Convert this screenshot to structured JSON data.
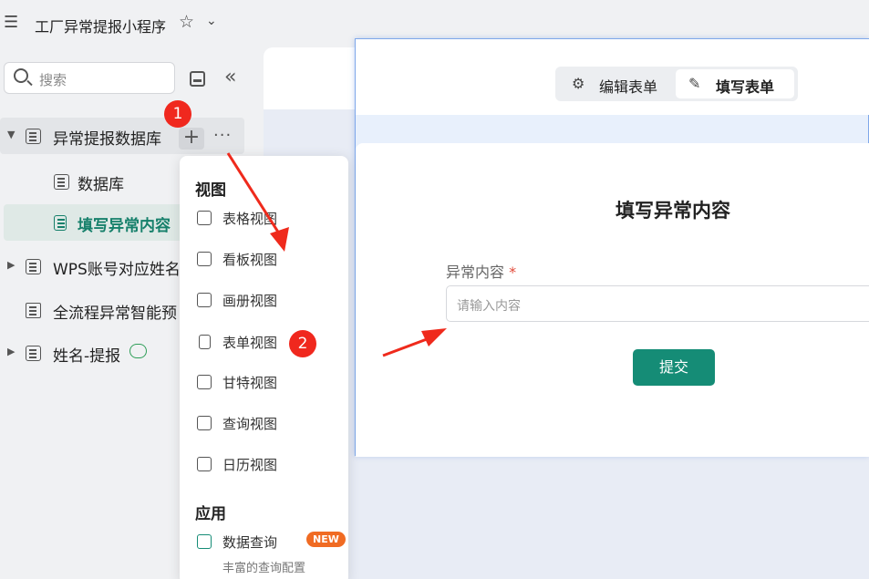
{
  "app": {
    "title": "工厂异常提报小程序",
    "menu_icon": "☰",
    "star_icon": "☆",
    "chevron_icon": "⌄"
  },
  "sidebar": {
    "search_placeholder": "搜索",
    "fold_icon": "«",
    "tree": [
      {
        "label": "异常提报数据库",
        "expanded": true
      },
      {
        "label": "数据库"
      },
      {
        "label": "填写异常内容",
        "active": true
      },
      {
        "label": "WPS账号对应姓名"
      },
      {
        "label": "全流程异常智能预"
      },
      {
        "label": "姓名-提报"
      }
    ],
    "plus_label": "+",
    "more_label": "···"
  },
  "badges": {
    "one": "1",
    "two": "2"
  },
  "dropdown": {
    "section_view": "视图",
    "views": [
      "表格视图",
      "看板视图",
      "画册视图",
      "表单视图",
      "甘特视图",
      "查询视图",
      "日历视图"
    ],
    "section_app": "应用",
    "app_item": "数据查询",
    "new_badge": "NEW",
    "app_desc": "丰富的查询配置"
  },
  "form": {
    "tab_edit": "编辑表单",
    "tab_fill": "填写表单",
    "tab_edit_icon": "⚙",
    "tab_fill_icon": "✎",
    "title": "填写异常内容",
    "field_label": "异常内容",
    "required_mark": "*",
    "input_placeholder": "请输入内容",
    "submit": "提交"
  },
  "colors": {
    "accent": "#158c76",
    "active_text": "#16806b",
    "badge_red": "#f0281e",
    "arrow_red": "#ef2a1c"
  }
}
